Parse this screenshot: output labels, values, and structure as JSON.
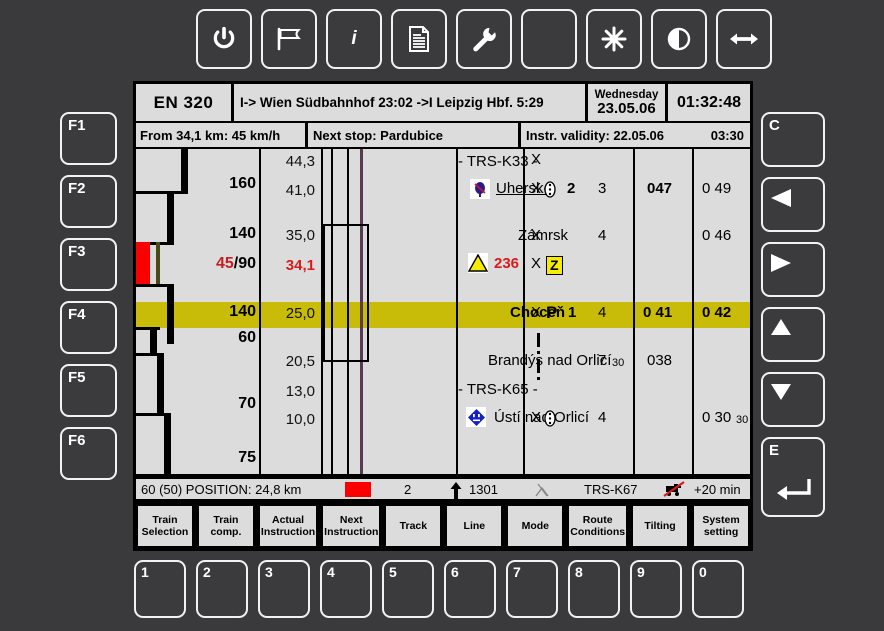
{
  "toolbar": {
    "buttons": [
      {
        "name": "power-icon",
        "label": ""
      },
      {
        "name": "flag-icon",
        "label": ""
      },
      {
        "name": "info-icon",
        "label": "i"
      },
      {
        "name": "document-icon",
        "label": ""
      },
      {
        "name": "wrench-icon",
        "label": ""
      },
      {
        "name": "blank-icon",
        "label": ""
      },
      {
        "name": "brightness-icon",
        "label": ""
      },
      {
        "name": "contrast-icon",
        "label": ""
      },
      {
        "name": "resize-arrows-icon",
        "label": ""
      }
    ]
  },
  "function_keys": [
    "F1",
    "F2",
    "F3",
    "F4",
    "F5",
    "F6"
  ],
  "right_keys": [
    {
      "name": "clear-key",
      "label": "C"
    },
    {
      "name": "left-arrow-key",
      "label": ""
    },
    {
      "name": "right-arrow-key",
      "label": ""
    },
    {
      "name": "up-arrow-key",
      "label": ""
    },
    {
      "name": "down-arrow-key",
      "label": ""
    },
    {
      "name": "enter-key",
      "label": "E"
    }
  ],
  "numeric_keys": [
    "1",
    "2",
    "3",
    "4",
    "5",
    "6",
    "7",
    "8",
    "9",
    "0"
  ],
  "header": {
    "train_number": "EN 320",
    "route": "I->  Wien Südbahnhof   23:02  ->I  Leipzig Hbf.  5:29",
    "day_name": "Wednesday",
    "date": "23.05.06",
    "clock": "01:32:48",
    "from_speed": "From 34,1 km: 45 km/h",
    "next_stop": "Next stop: Pardubice",
    "instr_validity_label": "Instr. validity: 22.05.06",
    "instr_validity_time": "03:30"
  },
  "speed_ladder": [
    {
      "label": "160",
      "red": false
    },
    {
      "label": "140",
      "red": false
    },
    {
      "label": "45",
      "label2": "/90",
      "red": true
    },
    {
      "label": "140",
      "red": false,
      "highlight": true
    },
    {
      "label": "60",
      "red": false
    },
    {
      "label": "70",
      "red": false
    },
    {
      "label": "75",
      "red": false
    }
  ],
  "rows": [
    {
      "km": "44,3",
      "km_red": false,
      "name": "- TRS-K33 -",
      "name_style": "center",
      "symbol": "",
      "marker": "",
      "c1": "X",
      "c2": "",
      "c3": "",
      "c4": "",
      "c5": "",
      "c5_sm": "",
      "highlight": false
    },
    {
      "km": "41,0",
      "km_red": false,
      "name": "Uhersko",
      "name_style": "underline",
      "symbol": "signal-post-icon",
      "marker": "",
      "c1": "X",
      "c1_icon": "signal-lamp-icon",
      "c2": "2",
      "c3": "3",
      "c4": "047",
      "c5": "0 49",
      "c5_sm": "",
      "highlight": false
    },
    {
      "km": "35,0",
      "km_red": false,
      "name": "Zámrsk",
      "name_style": "normal",
      "symbol": "",
      "marker": "",
      "c1": "X",
      "c2": "",
      "c3": "4",
      "c4": "",
      "c5": "0 46",
      "c5_sm": "",
      "highlight": false
    },
    {
      "km": "34,1",
      "km_red": true,
      "name": "236",
      "name_style": "warn",
      "symbol": "warning-triangle-icon",
      "marker": "",
      "c1": "X",
      "c1_badge": "Z",
      "c2": "",
      "c3": "",
      "c4": "",
      "c5": "",
      "c5_sm": "",
      "highlight": false
    },
    {
      "km": "25,0",
      "km_red": false,
      "name": "Choceň",
      "name_style": "bold",
      "symbol": "",
      "marker": "",
      "c1": "X",
      "c1_badge_p": "P",
      "c2": "1",
      "c3": "4",
      "c4": "0 41",
      "c5": "0 42",
      "c5_sm": "",
      "highlight": true
    },
    {
      "km": "20,5",
      "km_red": false,
      "name": "Brandýs nad Orlicí",
      "name_style": "normal",
      "symbol": "",
      "marker": "dotted-line",
      "c1": "",
      "c2": "",
      "c3": "7",
      "c3_sm": "30",
      "c4": "038",
      "c5": "",
      "c5_sm": "",
      "highlight": false
    },
    {
      "km": "13,0",
      "km_red": false,
      "name": "- TRS-K65 -",
      "name_style": "center",
      "symbol": "",
      "marker": "",
      "c1": "",
      "c2": "",
      "c3": "",
      "c4": "",
      "c5": "",
      "c5_sm": "",
      "highlight": false
    },
    {
      "km": "10,0",
      "km_red": false,
      "name": "Ústí nad Orlicí",
      "name_style": "normal",
      "symbol": "station-diamond-icon",
      "marker": "",
      "c1": "X",
      "c1_icon": "signal-lamp-icon",
      "c2": "",
      "c3": "4",
      "c4": "",
      "c5": "0 30",
      "c5_sm": "30",
      "highlight": false
    }
  ],
  "status_bar": {
    "position_text": "60 (50) POSITION:  24,8 km",
    "red_flag_color": "#fb0000",
    "track_number": "2",
    "gradient_arrow": "up-arrow-icon",
    "gradient_value": "1301",
    "pantograph_icon": "pantograph-icon",
    "trs_label": "TRS-K67",
    "no-horn_icon": "horn-crossed-icon",
    "delay": "+20 min"
  },
  "soft_buttons": [
    {
      "line1": "Train",
      "line2": "Selection"
    },
    {
      "line1": "Train",
      "line2": "comp."
    },
    {
      "line1": "Actual",
      "line2": "Instruction"
    },
    {
      "line1": "Next",
      "line2": "Instruction"
    },
    {
      "line1": "Track",
      "line2": ""
    },
    {
      "line1": "Line",
      "line2": ""
    },
    {
      "line1": "Mode",
      "line2": ""
    },
    {
      "line1": "Route",
      "line2": "Conditions"
    },
    {
      "line1": "Tilting",
      "line2": ""
    },
    {
      "line1": "System",
      "line2": "setting"
    }
  ],
  "colors": {
    "highlight": "#c8bc08",
    "red": "#d81b1b",
    "screen_bg": "#dcdcdc",
    "chassis": "#3a3a3c"
  }
}
